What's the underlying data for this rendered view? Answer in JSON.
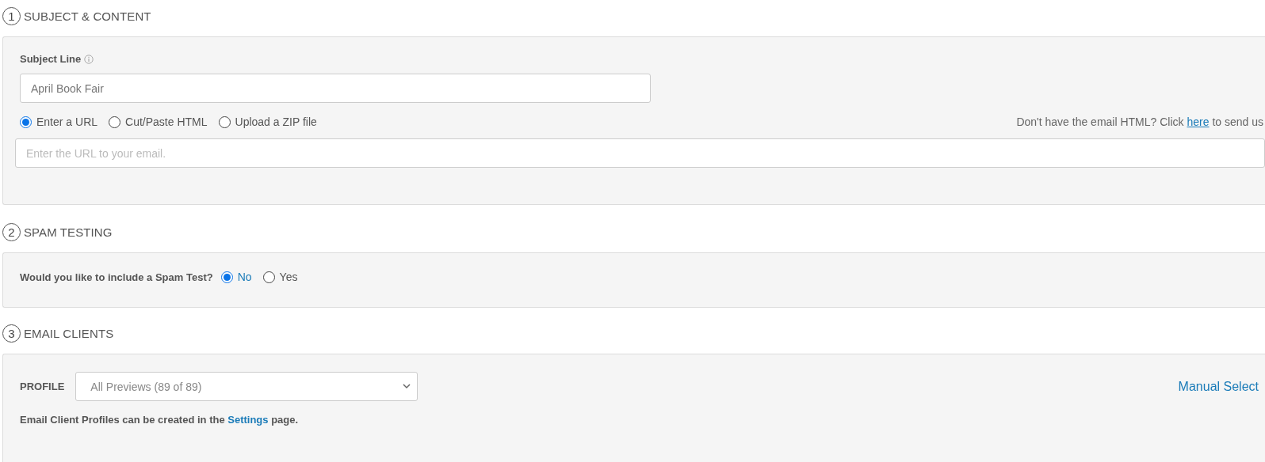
{
  "sections": [
    {
      "kind": "content",
      "number": "1",
      "title": "SUBJECT & CONTENT",
      "subject_label": "Subject Line",
      "subject_value": "April Book Fair",
      "source_options": [
        {
          "label": "Enter a URL",
          "selected": true
        },
        {
          "label": "Cut/Paste HTML",
          "selected": false
        },
        {
          "label": "Upload a ZIP file",
          "selected": false
        }
      ],
      "help": {
        "before": "Don't have the email HTML? Click ",
        "link": "here",
        "after": " to send us"
      },
      "url_placeholder": "Enter the URL to your email."
    },
    {
      "kind": "spam",
      "number": "2",
      "title": "SPAM TESTING",
      "question": "Would you like to include a Spam Test?",
      "options": [
        {
          "label": "No",
          "selected": true
        },
        {
          "label": "Yes",
          "selected": false
        }
      ]
    },
    {
      "kind": "clients",
      "number": "3",
      "title": "EMAIL CLIENTS",
      "profile_label": "PROFILE",
      "profile_value": "All Previews (89 of 89)",
      "manual_select": "Manual Select",
      "note": {
        "before": "Email Client Profiles can be created in the ",
        "link": "Settings",
        "after": " page."
      }
    },
    {
      "kind": "empty"
    }
  ]
}
